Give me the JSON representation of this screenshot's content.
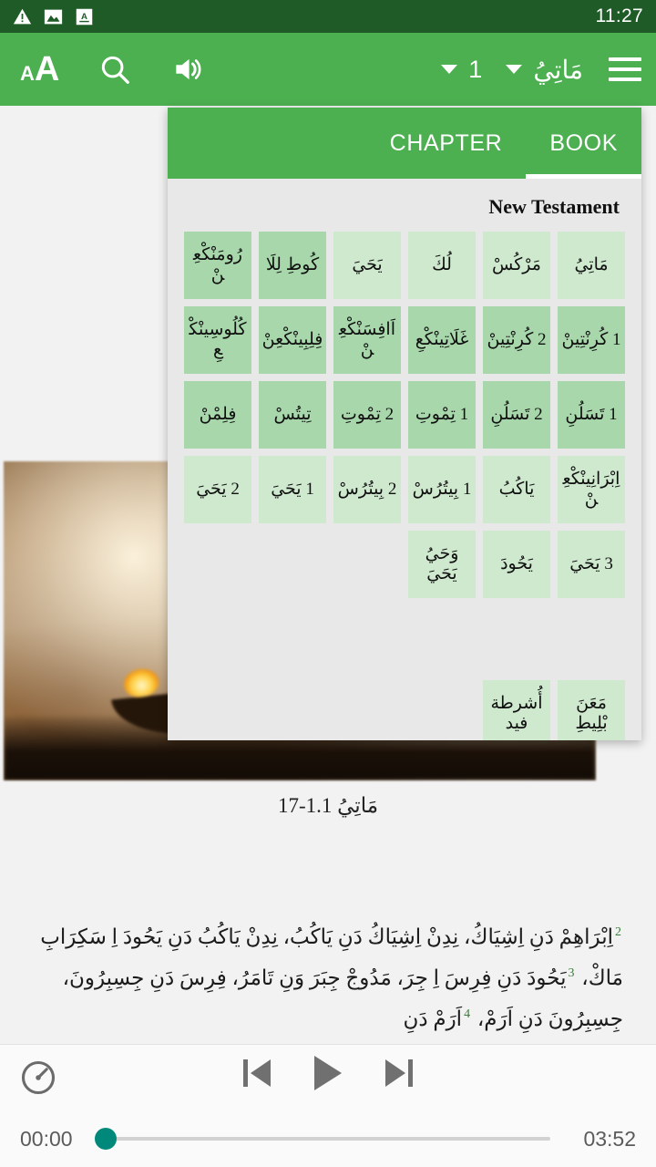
{
  "status_bar": {
    "icons": [
      "warning-triangle-icon",
      "image-icon",
      "font-a-icon"
    ],
    "clock": "11:27"
  },
  "toolbar": {
    "font_size_small": "A",
    "font_size_big": "A",
    "icons": [
      "font-size-icon",
      "search-icon",
      "audio-speaker-icon",
      "menu-icon"
    ],
    "chapter_value": "1",
    "book_value": "مَاتِيُ"
  },
  "panel": {
    "tabs": [
      {
        "label": "CHAPTER",
        "active": false
      },
      {
        "label": "BOOK",
        "active": true
      }
    ],
    "testament_title": "New Testament",
    "books": [
      {
        "label": "مَاتِيُ",
        "shade": "b"
      },
      {
        "label": "مَرْكُسْ",
        "shade": "b"
      },
      {
        "label": "لُكَ",
        "shade": "b"
      },
      {
        "label": "يَحَيَ",
        "shade": "b"
      },
      {
        "label": "كُوطِ لِلَا",
        "shade": "a"
      },
      {
        "label": "رُومَنْكْعِنْ",
        "shade": "a"
      },
      {
        "label": "1 كُرِنْتِينْ",
        "shade": "a"
      },
      {
        "label": "2 كُرِنْتِينْ",
        "shade": "a"
      },
      {
        "label": "غَلَاتِينْكْعِ",
        "shade": "a"
      },
      {
        "label": "اَافِسَنْكْعِنْ",
        "shade": "a"
      },
      {
        "label": "فِلِبِينْكْعِنْ",
        "shade": "a"
      },
      {
        "label": "كُلُوسِينْكْعِ",
        "shade": "a"
      },
      {
        "label": "1 تَسَلُنِ",
        "shade": "a"
      },
      {
        "label": "2 تَسَلُنِ",
        "shade": "a"
      },
      {
        "label": "1 تِمْوتِ",
        "shade": "a"
      },
      {
        "label": "2 تِمْوتِ",
        "shade": "a"
      },
      {
        "label": "تِيتُسْ",
        "shade": "a"
      },
      {
        "label": "فِلِمْنْ",
        "shade": "a"
      },
      {
        "label": "اِبْرَانِينْكْعِنْ",
        "shade": "b"
      },
      {
        "label": "يَاكُبُ",
        "shade": "b"
      },
      {
        "label": "1 بِيتُرُسْ",
        "shade": "b"
      },
      {
        "label": "2 بِيتُرُسْ",
        "shade": "b"
      },
      {
        "label": "1 يَحَيَ",
        "shade": "b"
      },
      {
        "label": "2 يَحَيَ",
        "shade": "b"
      },
      {
        "label": "3 يَحَيَ",
        "shade": "b"
      },
      {
        "label": "يَحُودَ",
        "shade": "b"
      },
      {
        "label": "وَحَيُ يَحَيَ",
        "shade": "b"
      },
      {
        "label": "",
        "shade": "empty"
      },
      {
        "label": "",
        "shade": "empty"
      },
      {
        "label": "",
        "shade": "empty"
      },
      {
        "label": "",
        "shade": "empty"
      },
      {
        "label": "",
        "shade": "empty"
      },
      {
        "label": "",
        "shade": "empty"
      },
      {
        "label": "",
        "shade": "empty"
      },
      {
        "label": "",
        "shade": "empty"
      },
      {
        "label": "",
        "shade": "empty"
      },
      {
        "label": "مَعَنَ بْلِيطِ",
        "shade": "b"
      },
      {
        "label": "أُشرطة فيد",
        "shade": "b"
      },
      {
        "label": "",
        "shade": "empty"
      },
      {
        "label": "",
        "shade": "empty"
      },
      {
        "label": "",
        "shade": "empty"
      },
      {
        "label": "",
        "shade": "empty"
      }
    ]
  },
  "reader": {
    "caption": "مَاتِيُ 1.1-17",
    "verses": [
      {
        "number": "2",
        "text": "اِبْرَاهِمْ دَنِ اِشِيَاكُ، نِدِنْ اِشِيَاكُ دَنِ يَاكُبُ، نِدِنْ يَاكُبُ دَنِ يَحُودَ اِ سَكِرَابِ مَاكْ،"
      },
      {
        "number": "3",
        "text": "يَحُودَ دَنِ فِرِسَ اِ جِرَ، مَدُوجْ جِبَرَ وَنِ تَامَرُ، فِرِسَ دَنِ جِسِبِرُونَ، جِسِبِرُونَ دَنِ اَرَمْ،"
      },
      {
        "number": "4",
        "text": "اَرَمْ دَنِ"
      }
    ]
  },
  "player": {
    "speed_icon": "playback-speed-icon",
    "prev_label": "previous-track",
    "play_label": "play",
    "next_label": "next-track",
    "current_time": "00:00",
    "total_time": "03:52",
    "progress_percent": 0,
    "accent_color": "#00897b"
  }
}
